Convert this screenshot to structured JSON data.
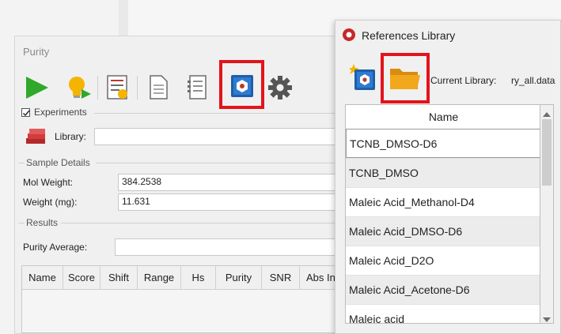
{
  "purity_window": {
    "title": "Purity",
    "toolbar": {
      "run": "play-icon",
      "suggest": "lightbulb-icon",
      "report_list": "checklist-icon",
      "document": "document-icon",
      "notes": "notes-icon",
      "references_library": "library-book-icon",
      "settings": "gear-icon"
    },
    "experiments": {
      "label": "Experiments",
      "checked": true,
      "library_label": "Library:",
      "library_value": ""
    },
    "sample_details": {
      "legend": "Sample Details",
      "mol_weight_label": "Mol Weight:",
      "mol_weight_value": "384.2538",
      "weight_label": "Weight (mg):",
      "weight_value": "11.631"
    },
    "results": {
      "legend": "Results",
      "purity_average_label": "Purity Average:",
      "purity_average_value": "",
      "columns": [
        "Name",
        "Score",
        "Shift",
        "Range",
        "Hs",
        "Purity",
        "SNR",
        "Abs In"
      ]
    }
  },
  "references_window": {
    "title": "References Library",
    "new_library_icon": "new-library-icon",
    "open_folder_icon": "open-folder-icon",
    "current_library_label": "Current Library:",
    "current_library_value": "ry_all.data",
    "list_header": "Name",
    "items": [
      "TCNB_DMSO-D6",
      "TCNB_DMSO",
      "Maleic Acid_Methanol-D4",
      "Maleic Acid_DMSO-D6",
      "Maleic Acid_D2O",
      "Maleic Acid_Acetone-D6",
      "Maleic acid"
    ]
  },
  "colors": {
    "highlight": "#e3141b",
    "play": "#2fa82b",
    "folder": "#f2a81c",
    "row_alt": "#ececec"
  }
}
